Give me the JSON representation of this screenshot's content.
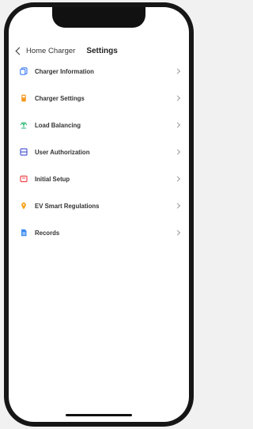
{
  "nav": {
    "back_label": "Home Charger",
    "title": "Settings"
  },
  "menu": {
    "items": [
      {
        "label": "Charger Information",
        "icon": "info-doc-icon",
        "color": "#3b7bf6"
      },
      {
        "label": "Charger Settings",
        "icon": "charger-icon",
        "color": "#f59a23"
      },
      {
        "label": "Load Balancing",
        "icon": "balance-icon",
        "color": "#2bb673"
      },
      {
        "label": "User Authorization",
        "icon": "user-list-icon",
        "color": "#4f5bd5"
      },
      {
        "label": "Initial Setup",
        "icon": "setup-icon",
        "color": "#f0454a"
      },
      {
        "label": "EV Smart Regulations",
        "icon": "location-icon",
        "color": "#f7a21b"
      },
      {
        "label": "Records",
        "icon": "records-icon",
        "color": "#3b8bf0"
      }
    ]
  }
}
